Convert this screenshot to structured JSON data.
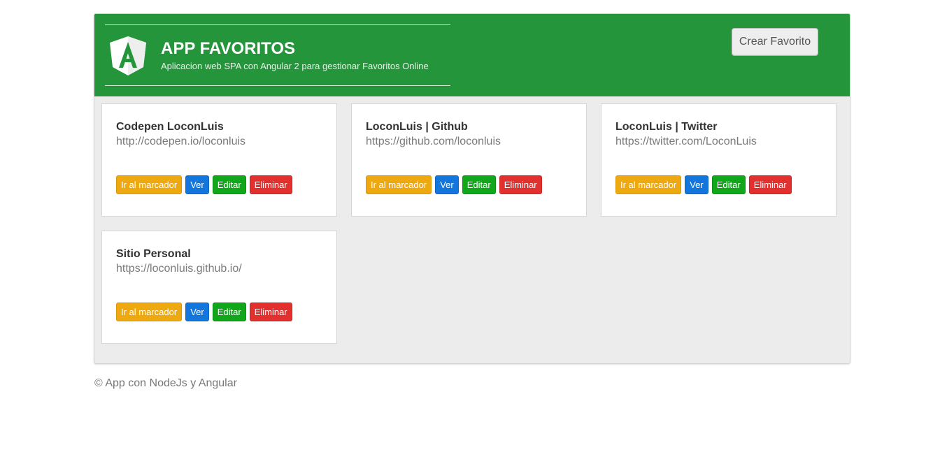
{
  "header": {
    "title": "APP FAVORITOS",
    "subtitle": "Aplicacion web SPA con Angular 2 para gestionar Favoritos Online",
    "logo_icon": "angular-logo-icon",
    "create_button": "Crear Favorito"
  },
  "colors": {
    "header_bg": "#24953a",
    "go_button": "#eea810",
    "view_button": "#1276dd",
    "edit_button": "#10a71b",
    "delete_button": "#e2302f"
  },
  "cards": [
    {
      "title": "Codepen LoconLuis",
      "url": "http://codepen.io/loconluis",
      "go_label": "Ir al marcador",
      "view_label": "Ver",
      "edit_label": "Editar",
      "delete_label": "Eliminar"
    },
    {
      "title": "LoconLuis | Github",
      "url": "https://github.com/loconluis",
      "go_label": "Ir al marcador",
      "view_label": "Ver",
      "edit_label": "Editar",
      "delete_label": "Eliminar"
    },
    {
      "title": "LoconLuis | Twitter",
      "url": "https://twitter.com/LoconLuis",
      "go_label": "Ir al marcador",
      "view_label": "Ver",
      "edit_label": "Editar",
      "delete_label": "Eliminar"
    },
    {
      "title": "Sitio Personal",
      "url": "https://loconluis.github.io/",
      "go_label": "Ir al marcador",
      "view_label": "Ver",
      "edit_label": "Editar",
      "delete_label": "Eliminar"
    }
  ],
  "footer": {
    "text": "© App con NodeJs y Angular"
  }
}
